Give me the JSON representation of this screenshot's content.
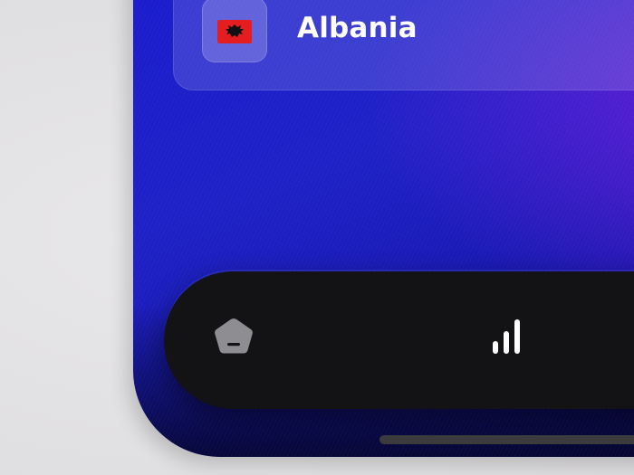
{
  "country_card": {
    "name": "Albania",
    "flag_icon": "albania-flag-icon",
    "flag_colors": {
      "field": "#e41e20",
      "eagle": "#000000"
    }
  },
  "tab_bar": {
    "tabs": [
      {
        "id": "home",
        "icon": "pentagon-home-icon",
        "color": "#8e8d92"
      },
      {
        "id": "stats",
        "icon": "signal-bars-icon",
        "color": "#ffffff"
      }
    ]
  },
  "theme": {
    "background": "#1c1ec8",
    "accent": "#6a1fd8",
    "tab_bar_bg": "#131214"
  }
}
